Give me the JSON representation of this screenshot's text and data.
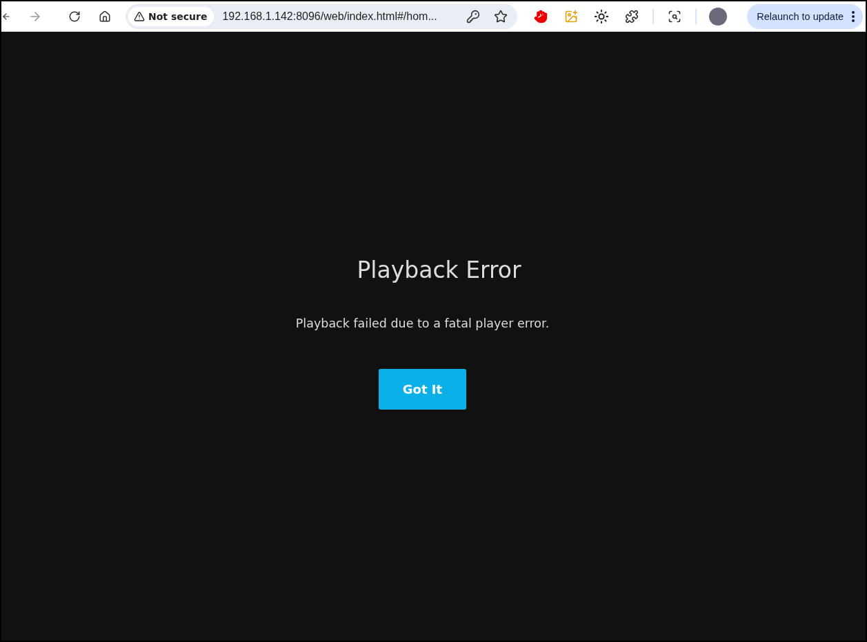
{
  "browser": {
    "security_label": "Not secure",
    "url": "192.168.1.142:8096/web/index.html#/hom...",
    "relaunch_button": "Relaunch to update"
  },
  "dialog": {
    "title": "Playback Error",
    "message": "Playback failed due to a fatal player error.",
    "button": "Got It"
  }
}
